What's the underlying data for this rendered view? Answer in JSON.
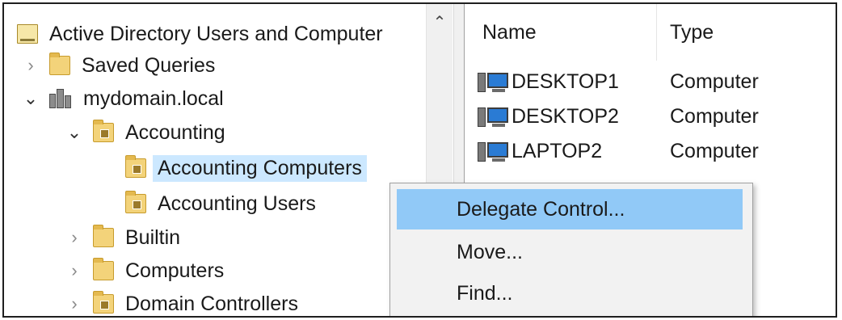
{
  "tree": {
    "root_label": "Active Directory Users and Computer",
    "items": [
      {
        "label": "Saved Queries"
      },
      {
        "label": "mydomain.local"
      },
      {
        "label": "Accounting"
      },
      {
        "label": "Accounting Computers"
      },
      {
        "label": "Accounting Users"
      },
      {
        "label": "Builtin"
      },
      {
        "label": "Computers"
      },
      {
        "label": "Domain Controllers"
      }
    ],
    "selected": "Accounting Computers"
  },
  "list": {
    "columns": [
      "Name",
      "Type"
    ],
    "rows": [
      {
        "name": "DESKTOP1",
        "type": "Computer"
      },
      {
        "name": "DESKTOP2",
        "type": "Computer"
      },
      {
        "name": "LAPTOP2",
        "type": "Computer"
      }
    ]
  },
  "context_menu": {
    "items": [
      "Delegate Control...",
      "Move...",
      "Find..."
    ],
    "highlighted": "Delegate Control..."
  },
  "colors": {
    "selection": "#cce8ff",
    "menu_highlight": "#91c9f7",
    "menu_background": "#f2f2f2"
  }
}
